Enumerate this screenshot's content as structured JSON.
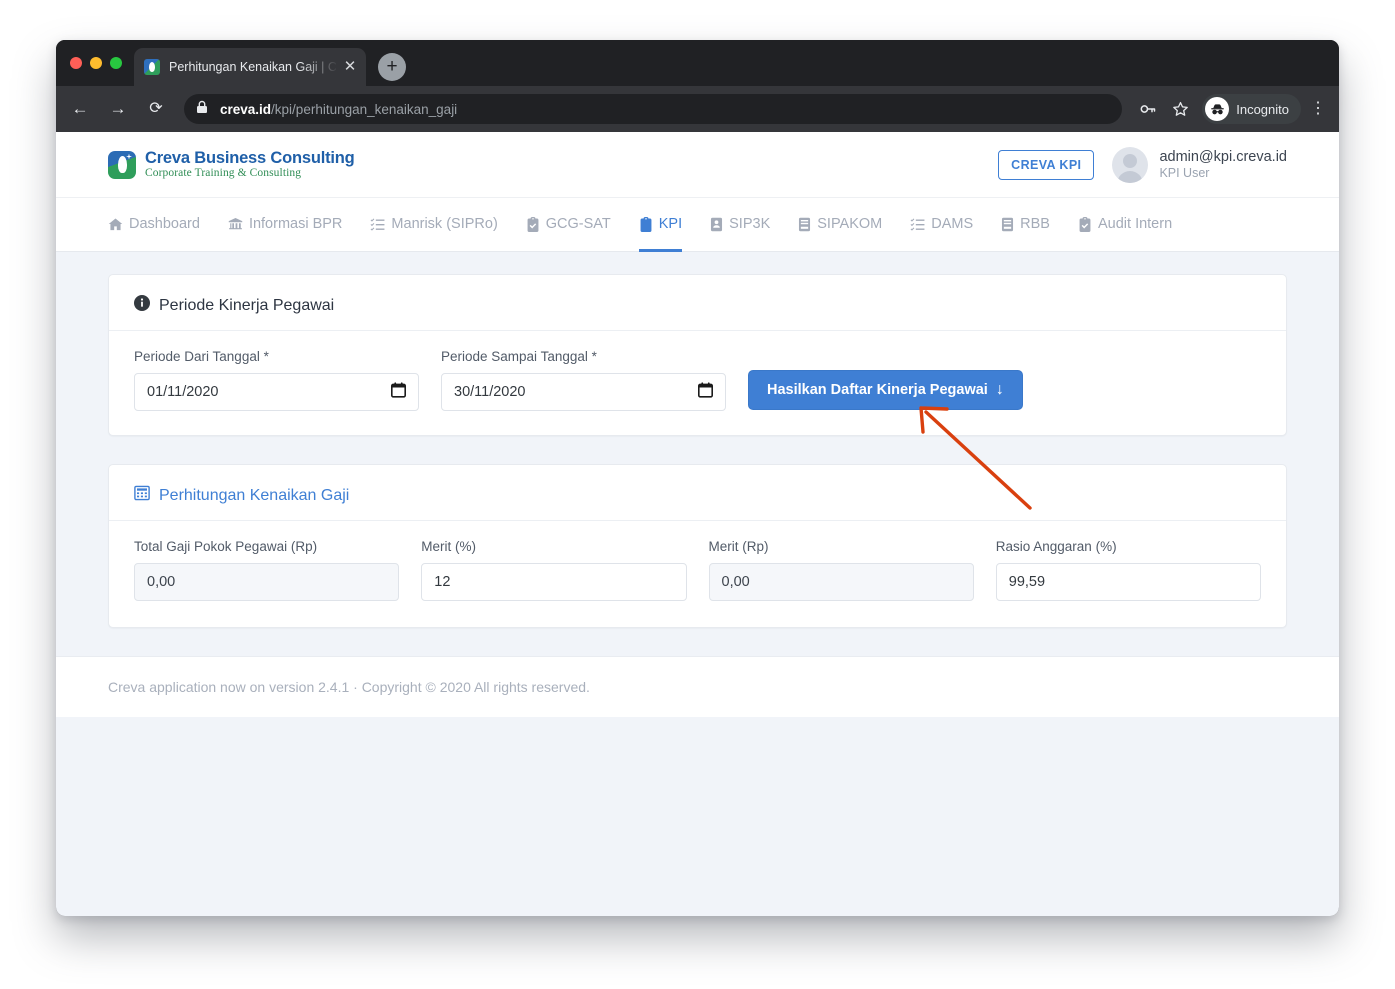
{
  "browser": {
    "tab_title": "Perhitungan Kenaikan Gaji | Cre",
    "tab_close_glyph": "✕",
    "new_tab_glyph": "+",
    "back_glyph": "←",
    "forward_glyph": "→",
    "reload_glyph": "⟳",
    "url_domain": "creva.id",
    "url_path": "/kpi/perhitungan_kenaikan_gaji",
    "profile_label": "Incognito",
    "menu_glyph": "⋮"
  },
  "header": {
    "logo_title": "Creva Business Consulting",
    "logo_subtitle": "Corporate Training & Consulting",
    "kpi_chip": "CREVA KPI",
    "user_email": "admin@kpi.creva.id",
    "user_role": "KPI User"
  },
  "nav": {
    "items": [
      {
        "label": "Dashboard",
        "icon": "home-icon",
        "active": false
      },
      {
        "label": "Informasi BPR",
        "icon": "bank-icon",
        "active": false
      },
      {
        "label": "Manrisk (SIPRo)",
        "icon": "list-icon",
        "active": false
      },
      {
        "label": "GCG-SAT",
        "icon": "clipboard-check-icon",
        "active": false
      },
      {
        "label": "KPI",
        "icon": "clipboard-list-icon",
        "active": true
      },
      {
        "label": "SIP3K",
        "icon": "id-card-icon",
        "active": false
      },
      {
        "label": "SIPAKOM",
        "icon": "book-icon",
        "active": false
      },
      {
        "label": "DAMS",
        "icon": "list-icon",
        "active": false
      },
      {
        "label": "RBB",
        "icon": "book-icon",
        "active": false
      },
      {
        "label": "Audit Intern",
        "icon": "clipboard-check-icon",
        "active": false
      }
    ]
  },
  "period_card": {
    "title": "Periode Kinerja Pegawai",
    "icon": "info-circle-icon",
    "from_label": "Periode Dari Tanggal *",
    "from_value": "01/11/2020",
    "to_label": "Periode Sampai Tanggal *",
    "to_value": "30/11/2020",
    "button_label": "Hasilkan Daftar Kinerja Pegawai",
    "button_arrow": "↓"
  },
  "salary_card": {
    "title": "Perhitungan Kenaikan Gaji",
    "icon": "calculator-icon",
    "fields": [
      {
        "label": "Total Gaji Pokok Pegawai (Rp)",
        "value": "0,00",
        "disabled": true
      },
      {
        "label": "Merit (%)",
        "value": "12",
        "disabled": false
      },
      {
        "label": "Merit (Rp)",
        "value": "0,00",
        "disabled": true
      },
      {
        "label": "Rasio Anggaran (%)",
        "value": "99,59",
        "disabled": false
      }
    ]
  },
  "footer": {
    "text": "Creva application now on version 2.4.1  ·  Copyright © 2020 All rights reserved."
  },
  "annotation": {
    "type": "arrow",
    "color": "#d9400f",
    "points_to": "Hasilkan Daftar Kinerja Pegawai button"
  },
  "colors": {
    "accent_blue": "#3f7fd4",
    "page_bg": "#f1f4f9",
    "annotation_red": "#d9400f",
    "logo_green": "#2f8d55"
  }
}
